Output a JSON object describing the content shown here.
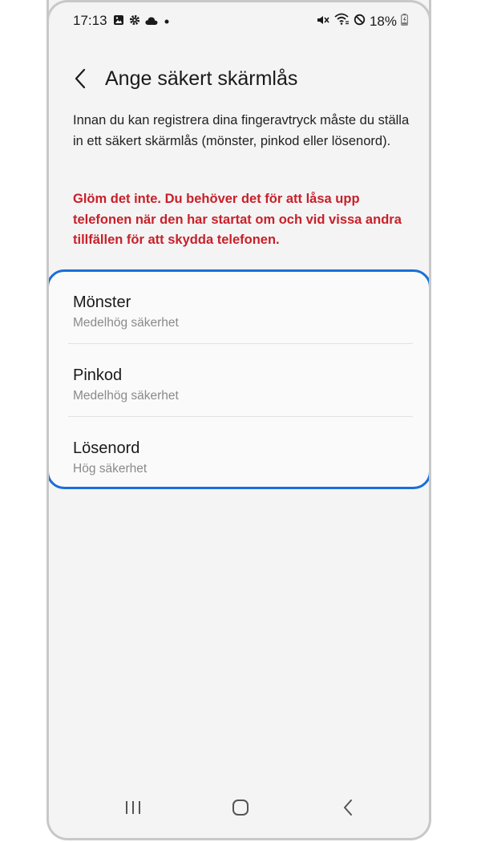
{
  "status_bar": {
    "time": "17:13",
    "battery": "18%",
    "left_icons": [
      "gallery-icon",
      "settings-gear-icon",
      "cloud-icon",
      "dot-icon"
    ],
    "right_icons": [
      "mute-vibrate-icon",
      "wifi-icon",
      "do-not-disturb-icon",
      "battery-charging-icon"
    ]
  },
  "header": {
    "title": "Ange säkert skärmlås",
    "back_icon": "chevron-left-icon"
  },
  "description": "Innan du kan registrera dina fingeravtryck måste du ställa in ett säkert skärmlås (mönster, pinkod eller lösenord).",
  "warning": "Glöm det inte. Du behöver det för att låsa upp telefonen när den har startat om och vid vissa andra tillfällen för att skydda telefonen.",
  "options": [
    {
      "title": "Mönster",
      "subtitle": "Medelhög säkerhet"
    },
    {
      "title": "Pinkod",
      "subtitle": "Medelhög säkerhet"
    },
    {
      "title": "Lösenord",
      "subtitle": "Hög säkerhet"
    }
  ],
  "nav_bar": {
    "icons": [
      "recent-apps-icon",
      "home-icon",
      "back-icon"
    ]
  },
  "colors": {
    "background": "#f4f4f4",
    "warning": "#c8202a",
    "highlight_border": "#1a6fd8",
    "subtitle": "#8a8a8a"
  }
}
